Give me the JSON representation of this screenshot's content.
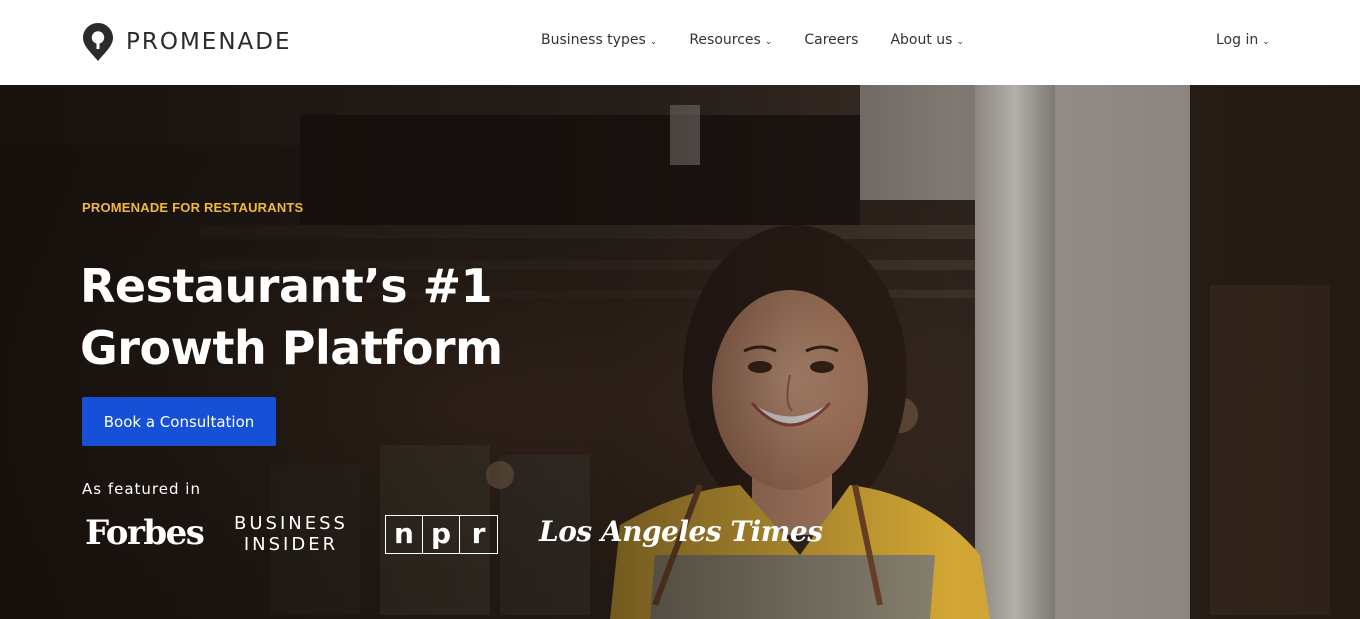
{
  "brand": {
    "name": "PROMENADE",
    "logo_icon": "map-pin-icon"
  },
  "nav": {
    "items": [
      {
        "label": "Business types",
        "dropdown": true
      },
      {
        "label": "Resources",
        "dropdown": true
      },
      {
        "label": "Careers",
        "dropdown": false
      },
      {
        "label": "About us",
        "dropdown": true
      }
    ],
    "login": {
      "label": "Log in",
      "dropdown": true
    },
    "caret_glyph": "⌄"
  },
  "hero": {
    "eyebrow": "PROMENADE FOR RESTAURANTS",
    "headline_line1": "Restaurant’s #1",
    "headline_line2": "Growth Platform",
    "cta_label": "Book a Consultation",
    "featured_label": "As featured in",
    "press": {
      "forbes": "Forbes",
      "business_insider_line1": "BUSINESS",
      "business_insider_line2": "INSIDER",
      "npr_letters": [
        "n",
        "p",
        "r"
      ],
      "la_times": "Los Angeles Times"
    }
  },
  "colors": {
    "accent_eyebrow": "#f0b93a",
    "cta_blue": "#1650d6",
    "header_bg": "#ffffff",
    "hero_text": "#ffffff",
    "apron_yellow": "#e8b83a"
  }
}
